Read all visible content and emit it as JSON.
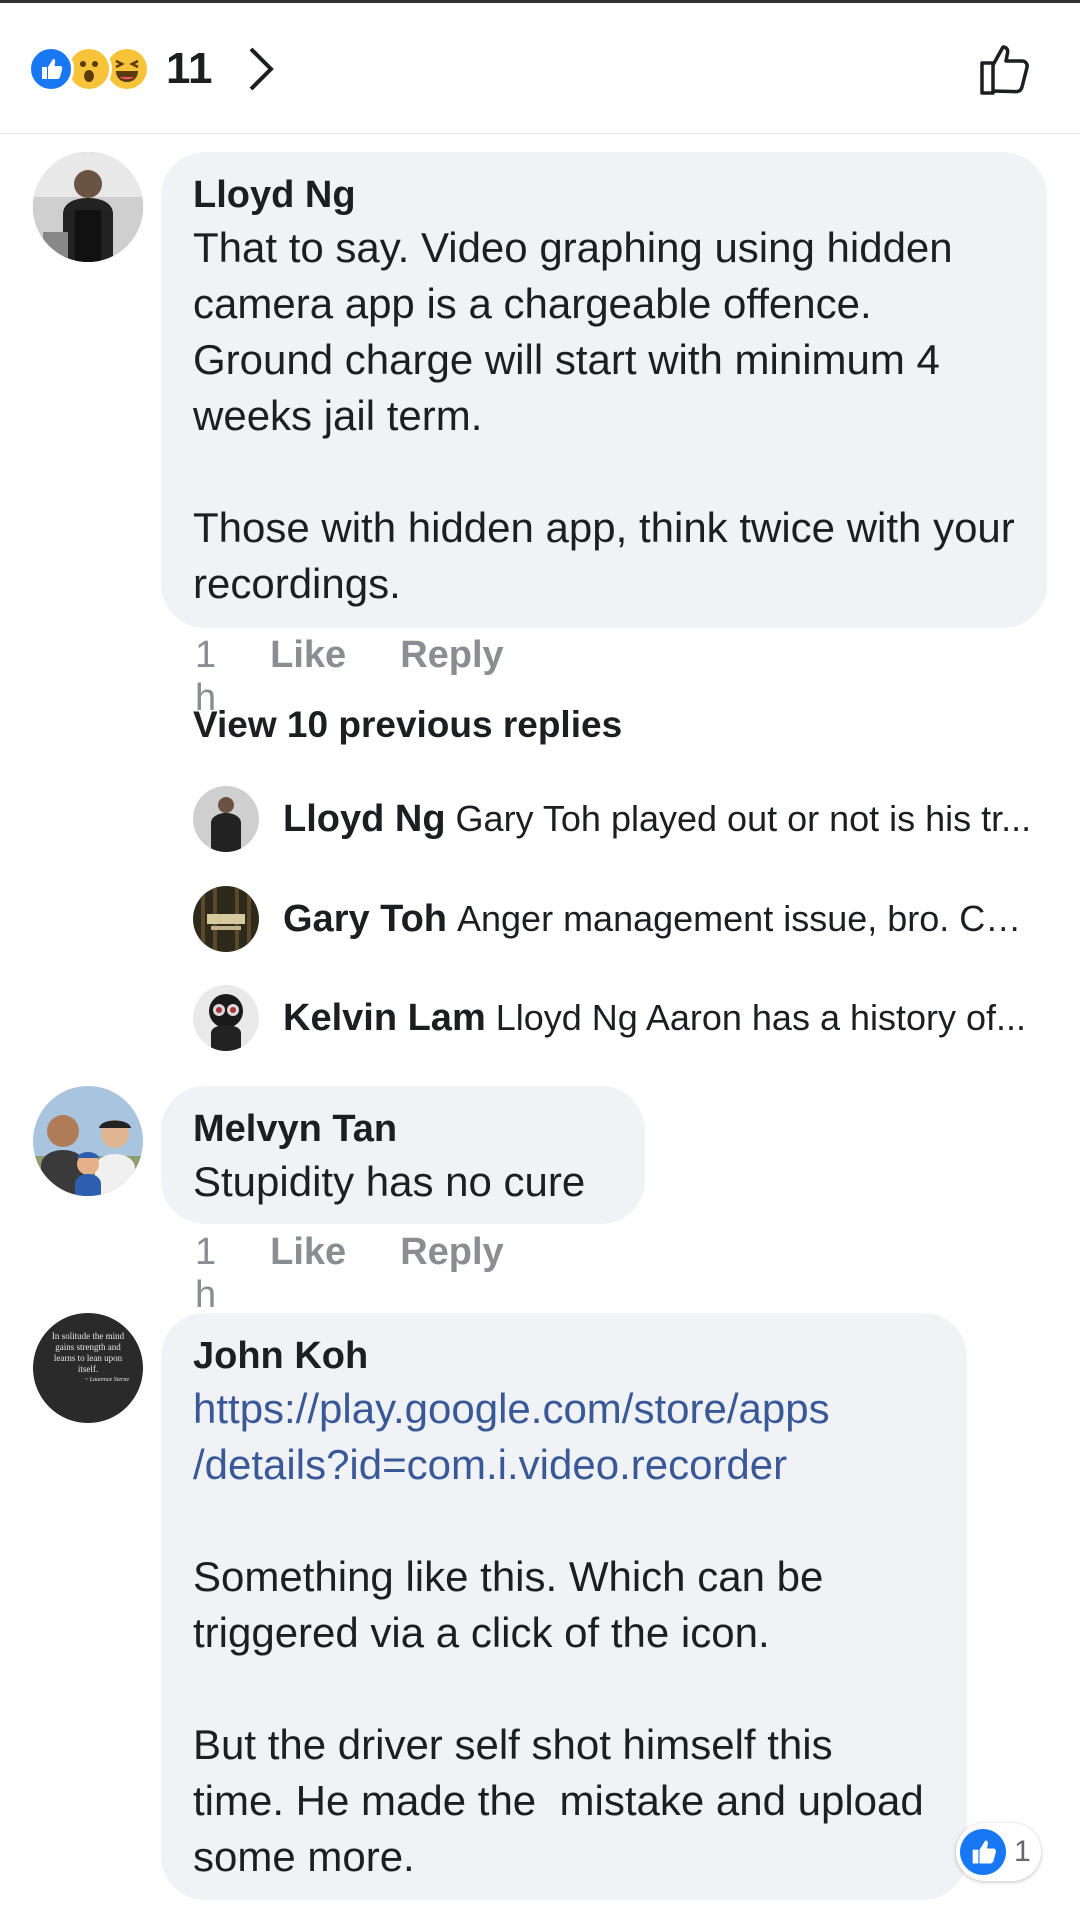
{
  "reactions": {
    "count": "11",
    "types": [
      "like",
      "wow",
      "haha"
    ]
  },
  "comments": [
    {
      "author": "Lloyd Ng",
      "text": "That to say. Video graphing using hidden camera app is a chargeable offence. Ground charge will start with minimum 4 weeks jail term.\n\nThose with hidden app, think twice with your recordings.",
      "time": "1 h",
      "like": "Like",
      "reply": "Reply"
    },
    {
      "author": "Melvyn Tan",
      "text": "Stupidity has no cure",
      "time": "1 h",
      "like": "Like",
      "reply": "Reply"
    },
    {
      "author": "John Koh",
      "link": "https://play.google.com/store/apps\n/details?id=com.i.video.recorder",
      "text": "Something like this. Which can be triggered via a click of the icon.\n\nBut the driver self shot himself this time. He made the  mistake and upload some more.",
      "like_count": "1"
    }
  ],
  "view_previous": "View 10 previous replies",
  "replies": [
    {
      "author": "Lloyd Ng",
      "text": "Gary Toh played out or not is his tr..."
    },
    {
      "author": "Gary Toh",
      "text": "Anger management issue, bro. Co..."
    },
    {
      "author": "Kelvin Lam",
      "text": "Lloyd Ng Aaron has a history of..."
    }
  ],
  "avatar_quote": "In solitude the mind gains strength and learns to lean upon itself.",
  "avatar_quote_attribution": "~ Laurence Sterne",
  "colors": {
    "accent": "#1877f2",
    "bubble": "#f0f2f5",
    "link": "#385898",
    "meta": "#8a8d91"
  }
}
